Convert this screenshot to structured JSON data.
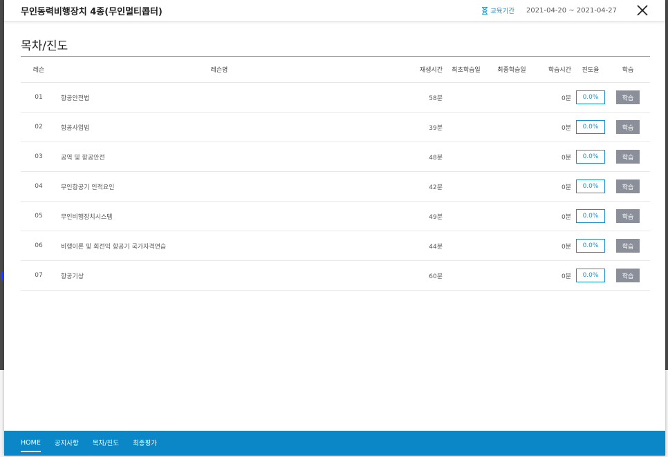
{
  "header": {
    "course_title": "무인동력비행장치 4종(무인멀티콥터)",
    "period_label": "교육기간",
    "period_dates": "2021-04-20 ~ 2021-04-27",
    "close_icon": "close-icon",
    "period_icon": "hourglass-icon"
  },
  "section": {
    "title": "목차/진도"
  },
  "table": {
    "columns": {
      "lesson": "레슨",
      "name": "레슨명",
      "play_time": "재생시간",
      "first_study": "최초학습일",
      "last_study": "최종학습일",
      "study_time": "학습시간",
      "progress": "진도율",
      "study": "학습"
    },
    "rows": [
      {
        "num": "01",
        "name": "항공안전법",
        "play_time": "58분",
        "first": "",
        "last": "",
        "study_time": "0분",
        "progress": "0.0%",
        "button": "학습"
      },
      {
        "num": "02",
        "name": "항공사업법",
        "play_time": "39분",
        "first": "",
        "last": "",
        "study_time": "0분",
        "progress": "0.0%",
        "button": "학습"
      },
      {
        "num": "03",
        "name": "공역 및 항공안전",
        "play_time": "48분",
        "first": "",
        "last": "",
        "study_time": "0분",
        "progress": "0.0%",
        "button": "학습"
      },
      {
        "num": "04",
        "name": "무인항공기 인적요인",
        "play_time": "42분",
        "first": "",
        "last": "",
        "study_time": "0분",
        "progress": "0.0%",
        "button": "학습"
      },
      {
        "num": "05",
        "name": "무인비행장치시스템",
        "play_time": "49분",
        "first": "",
        "last": "",
        "study_time": "0분",
        "progress": "0.0%",
        "button": "학습"
      },
      {
        "num": "06",
        "name": "비행이론 및 회전익 항공기 국가자격연습",
        "play_time": "44분",
        "first": "",
        "last": "",
        "study_time": "0분",
        "progress": "0.0%",
        "button": "학습"
      },
      {
        "num": "07",
        "name": "항공기상",
        "play_time": "60분",
        "first": "",
        "last": "",
        "study_time": "0분",
        "progress": "0.0%",
        "button": "학습"
      }
    ]
  },
  "footer_nav": {
    "items": [
      "HOME",
      "공지사항",
      "목차/진도",
      "최종평가"
    ],
    "active_index": 0
  },
  "colors": {
    "accent": "#1a8fd0",
    "footer_bg": "#0b87c8",
    "study_button": "#8a8f9a"
  }
}
